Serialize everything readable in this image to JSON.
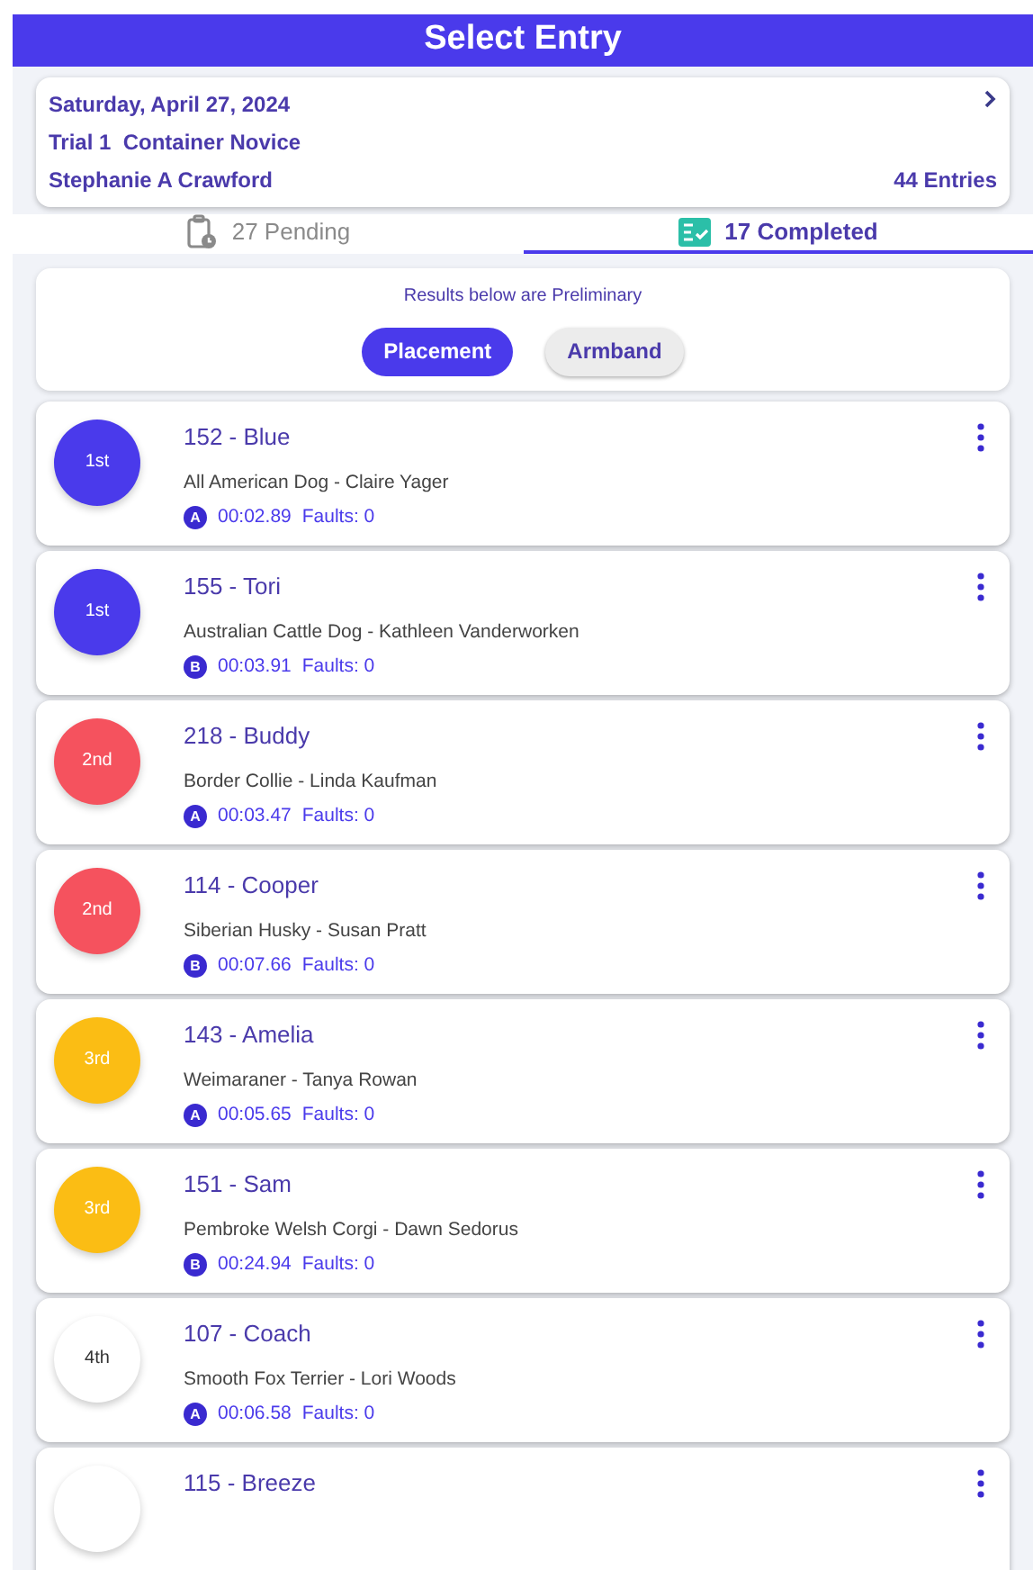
{
  "header": {
    "title": "Select Entry"
  },
  "info": {
    "date": "Saturday, April 27, 2024",
    "trial": "Trial 1  Container Novice",
    "judge": "Stephanie A Crawford",
    "entries": "44 Entries"
  },
  "tabs": [
    {
      "label": "27 Pending",
      "kind": "pending",
      "selected": false
    },
    {
      "label": "17 Completed",
      "kind": "completed",
      "selected": true
    }
  ],
  "notice": "Results below are Preliminary",
  "sort": [
    {
      "label": "Placement",
      "selected": true
    },
    {
      "label": "Armband",
      "selected": false
    }
  ],
  "entries": [
    {
      "place": "1st",
      "color": "#4a3aeb",
      "title": "152 - Blue",
      "detail": "All American Dog - Claire Yager",
      "section": "A",
      "time": "00:02.89",
      "faults": "Faults: 0"
    },
    {
      "place": "1st",
      "color": "#4a3aeb",
      "title": "155 - Tori",
      "detail": "Australian Cattle Dog - Kathleen Vanderworken",
      "section": "B",
      "time": "00:03.91",
      "faults": "Faults: 0"
    },
    {
      "place": "2nd",
      "color": "#f5525e",
      "title": "218 - Buddy",
      "detail": "Border Collie - Linda  Kaufman",
      "section": "A",
      "time": "00:03.47",
      "faults": "Faults: 0"
    },
    {
      "place": "2nd",
      "color": "#f5525e",
      "title": "114 - Cooper",
      "detail": "Siberian Husky - Susan Pratt",
      "section": "B",
      "time": "00:07.66",
      "faults": "Faults: 0"
    },
    {
      "place": "3rd",
      "color": "#fbbd14",
      "title": "143 - Amelia",
      "detail": "Weimaraner - Tanya Rowan",
      "section": "A",
      "time": "00:05.65",
      "faults": "Faults: 0"
    },
    {
      "place": "3rd",
      "color": "#fbbd14",
      "title": "151 - Sam",
      "detail": "Pembroke Welsh Corgi - Dawn Sedorus",
      "section": "B",
      "time": "00:24.94",
      "faults": "Faults: 0"
    },
    {
      "place": "4th",
      "color": "#ffffff",
      "title": "107 - Coach",
      "detail": "Smooth Fox Terrier - Lori Woods",
      "section": "A",
      "time": "00:06.58",
      "faults": "Faults: 0"
    },
    {
      "color": "#ffffff",
      "title": "115 - Breeze"
    }
  ]
}
